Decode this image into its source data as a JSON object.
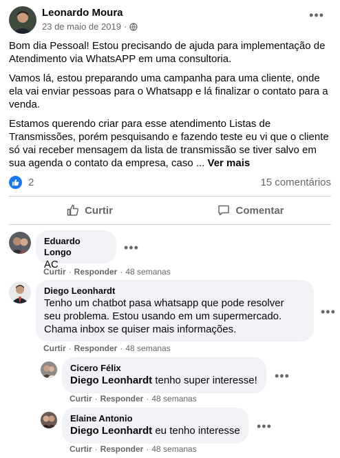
{
  "post": {
    "author": "Leonardo Moura",
    "date": "23 de maio de 2019",
    "meta_separator": "·",
    "privacy_icon": "globe-icon",
    "more_icon": "•••",
    "paragraphs": [
      "Bom dia Pessoal! Estou precisando de ajuda para implementação de Atendimento via WhatsAPP em uma consultoria.",
      "Vamos lá, estou preparando uma campanha para uma cliente, onde ela vai enviar pessoas para o Whatsapp e lá finalizar o contato para a venda.",
      "Estamos querendo criar para esse atendimento Listas de Transmissões, porém pesquisando e fazendo teste eu vi que o cliente só vai receber mensagem da lista de transmissão se tiver salvo em sua agenda o contato da empresa, caso ..."
    ],
    "see_more": "Ver mais",
    "reaction_count": "2",
    "comments_count": "15 comentários",
    "like_label": "Curtir",
    "comment_label": "Comentar"
  },
  "comments": [
    {
      "name": "Eduardo Longo",
      "text": "AC",
      "like": "Curtir",
      "reply": "Responder",
      "time": "48 semanas"
    },
    {
      "name": "Diego Leonhardt",
      "text_lines": [
        "Tenho um chatbot pasa whatsapp que pode resolver",
        "seu problema. Estou usando em um supermercado.",
        "Chama inbox se quiser mais informações."
      ],
      "like": "Curtir",
      "reply": "Responder",
      "time": "48 semanas"
    }
  ],
  "replies": [
    {
      "name": "Cicero Félix",
      "mention": "Diego Leonhardt",
      "text": "tenho super interesse!",
      "like": "Curtir",
      "reply": "Responder",
      "time": "48 semanas"
    },
    {
      "name": "Elaine Antonio",
      "mention": "Diego Leonhardt",
      "text": "eu tenho interesse",
      "like": "Curtir",
      "reply": "Responder",
      "time": "48 semanas"
    }
  ],
  "colors": {
    "accent": "#1877f2",
    "secondary_text": "#65676b",
    "bubble": "#f0f2f5"
  }
}
